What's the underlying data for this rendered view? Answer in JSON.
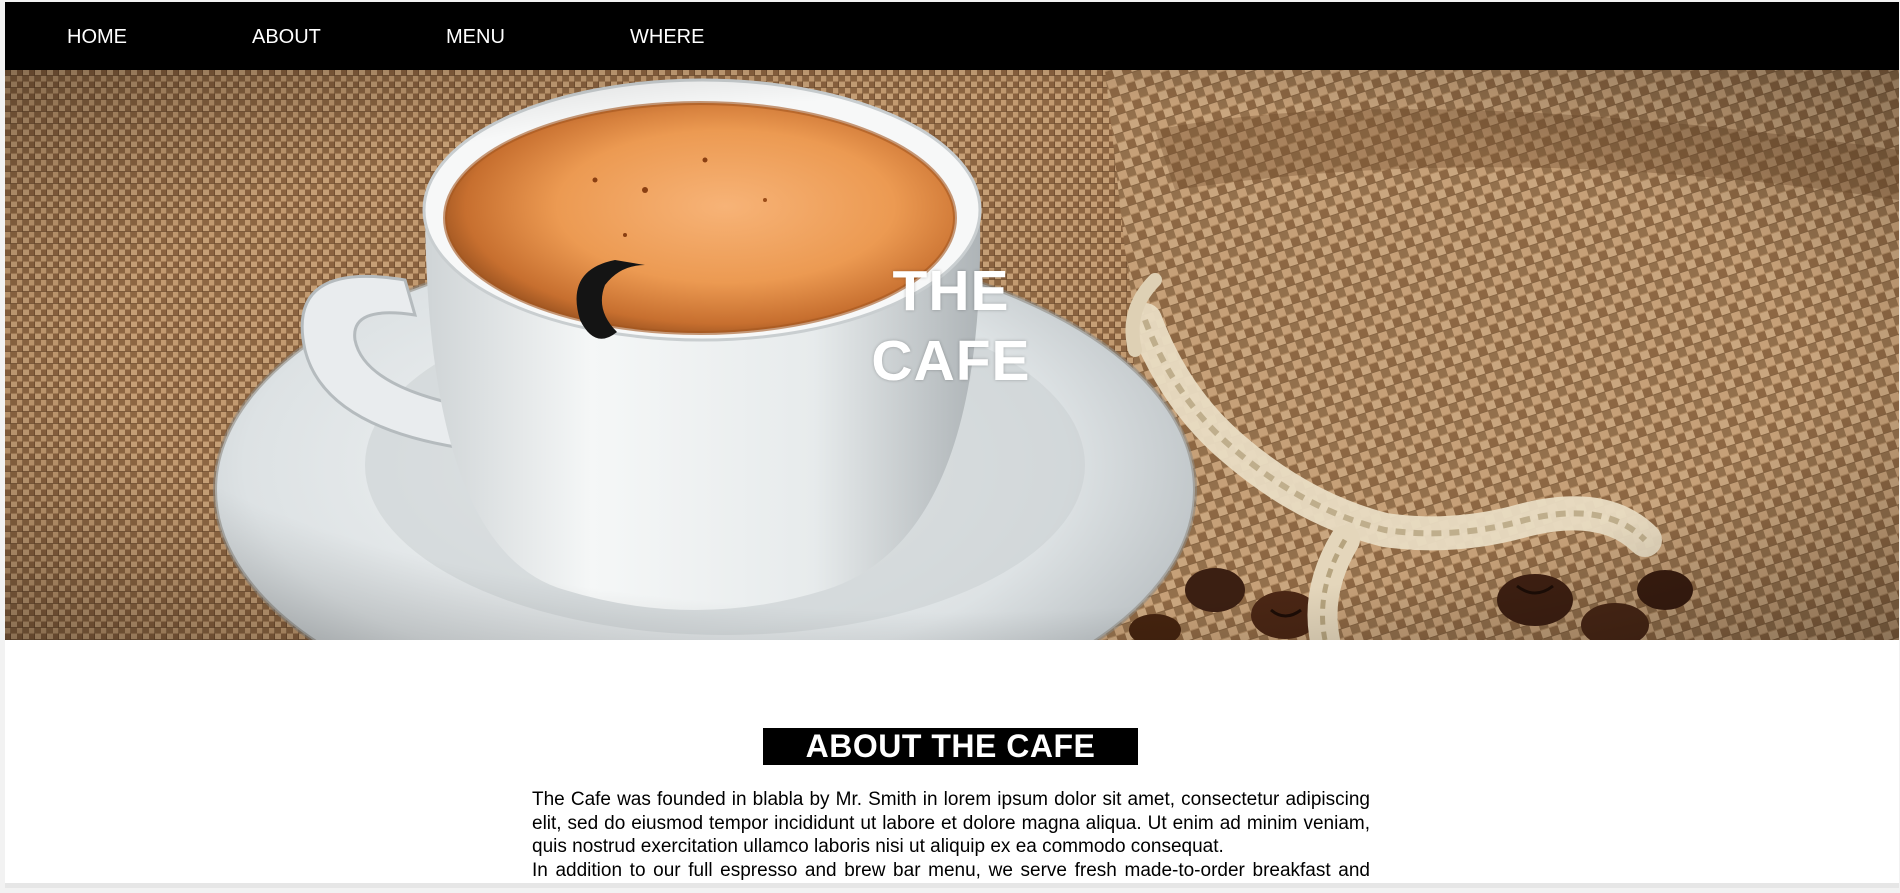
{
  "nav": {
    "items": [
      {
        "label": "HOME"
      },
      {
        "label": "ABOUT"
      },
      {
        "label": "MENU"
      },
      {
        "label": "WHERE"
      }
    ]
  },
  "hero": {
    "title_line1": "THE",
    "title_line2": "CAFE",
    "image": "coffee-cup-on-burlap-image"
  },
  "about": {
    "heading": "ABOUT THE CAFE",
    "paragraph1": "The Cafe was founded in blabla by Mr. Smith in lorem ipsum dolor sit amet, consectetur adipiscing elit, sed do eiusmod tempor incididunt ut labore et dolore magna aliqua. Ut enim ad minim veniam, quis nostrud exercitation ullamco laboris nisi ut aliquip ex ea commodo consequat.",
    "paragraph2": "In addition to our full espresso and brew bar menu, we serve fresh made-to-order breakfast and lunch sandwiches, as well as a selection of sides and salads and other good stuff."
  },
  "colors": {
    "nav_bg": "#000000",
    "nav_text": "#ffffff",
    "heading_bg": "#000000",
    "heading_text": "#ffffff",
    "body_text": "#000000"
  }
}
